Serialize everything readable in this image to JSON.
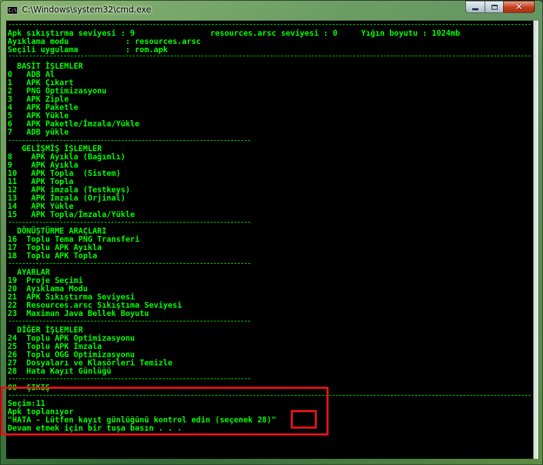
{
  "window": {
    "title": "C:\\Windows\\system32\\cmd.exe",
    "icon_label": "C:\\",
    "minimize_icon": "minimize-icon",
    "maximize_icon": "maximize-icon",
    "close_glyph": "✕"
  },
  "colors": {
    "console_background": "#000000",
    "console_text": "#00ff00",
    "highlight_box": "#e8101a"
  },
  "header": {
    "row1": "Apk sıkıştırma seviyesi : 9                resources.arsc seviyesi : 0     Yığın boyutu : 1024mb",
    "row2": "Ayıklama modu            : resources.arsc",
    "row3": "Seçili uygulama          : rom.apk"
  },
  "basic": {
    "title": "  BASİT İŞLEMLER",
    "items": [
      "0   ADB Al",
      "1   APK Çıkart",
      "2   PNG Optimizasyonu",
      "3   APK Ziple",
      "4   APK Paketle",
      "5   APK Yükle",
      "6   APK Paketle/İmzala/Yükle",
      "7   ADB yükle"
    ]
  },
  "advanced": {
    "title": "   GELİŞMİŞ İŞLEMLER",
    "items": [
      "8    APK Ayıkla (Bağımlı)",
      "9    APK Ayıkla",
      "10   APK Topla  (Sistem)",
      "11   APK Topla",
      "12   APK imzala (Testkeys)",
      "13   APK İmzala (Orjinal)",
      "14   APK Yükle",
      "15   APK Topla/İmzala/Yükle"
    ]
  },
  "conversion": {
    "title": "  DÖNÜŞTÜRME ARAÇLARI",
    "items": [
      "16  Toplu Tema PNG Transferi",
      "17  Toplu APK Ayıkla",
      "18  Toplu APK Topla"
    ]
  },
  "settings": {
    "title": "  AYARLAR",
    "items": [
      "19  Proje Seçimi",
      "20  Ayıklama Modu",
      "21  APK Sıkıştırma Seviyesi",
      "22  Resources.arsc Sıkıştıma Seviyesi",
      "23  Maximun Java Bellek Boyutu"
    ]
  },
  "other": {
    "title": "  DİĞER İŞLEMLER",
    "items": [
      "24  Toplu APK Optimizasyonu",
      "25  Toplu APK İmzala",
      "26  Toplu OGG Optimizasyonu",
      "27  Dosyaları ve Klasörleri Temizle",
      "28  Hata Kayıt Günlüğü"
    ]
  },
  "exit_line": "00  ÇIKIŞ",
  "output": {
    "prompt": "Seçim:11",
    "line1": "Apk toplanıyor",
    "line2": "\"HATA - Lütfen kayıt günlüğünü kontrol edin (seçenek 28)\"",
    "line3": "Devam etmek için bir tuşa basın . . ."
  }
}
